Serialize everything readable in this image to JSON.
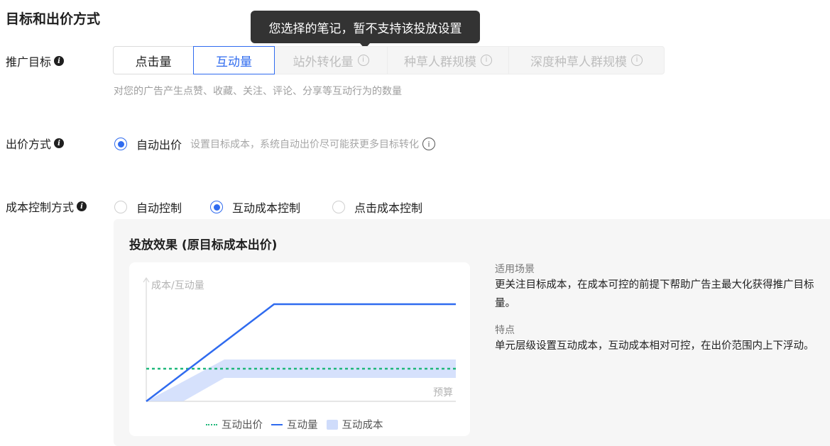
{
  "section": {
    "title": "目标和出价方式"
  },
  "tooltip": {
    "text": "您选择的笔记，暂不支持该投放设置"
  },
  "promotion_goal": {
    "label": "推广目标",
    "options": [
      {
        "label": "点击量",
        "state": "normal"
      },
      {
        "label": "互动量",
        "state": "selected"
      },
      {
        "label": "站外转化量",
        "state": "disabled"
      },
      {
        "label": "种草人群规模",
        "state": "disabled"
      },
      {
        "label": "深度种草人群规模",
        "state": "disabled"
      }
    ],
    "hint": "对您的广告产生点赞、收藏、关注、评论、分享等互动行为的数量"
  },
  "bid_method": {
    "label": "出价方式",
    "option": "自动出价",
    "description": "设置目标成本，系统自动出价尽可能获更多目标转化"
  },
  "cost_control": {
    "label": "成本控制方式",
    "options": [
      {
        "label": "自动控制",
        "checked": false
      },
      {
        "label": "互动成本控制",
        "checked": true
      },
      {
        "label": "点击成本控制",
        "checked": false
      }
    ]
  },
  "effect": {
    "title": "投放效果 (原目标成本出价)",
    "scenario_heading": "适用场景",
    "scenario_text": "更关注目标成本，在成本可控的前提下帮助广告主最大化获得推广目标量。",
    "feature_heading": "特点",
    "feature_text": "单元层级设置互动成本，互动成本相对可控，在出价范围内上下浮动。"
  },
  "chart_data": {
    "type": "line",
    "ylabel": "成本/互动量",
    "xlabel": "预算",
    "series": [
      {
        "name": "互动出价",
        "style": "dotted",
        "color": "#1fb87a"
      },
      {
        "name": "互动量",
        "style": "solid",
        "color": "#2f6bef"
      },
      {
        "name": "互动成本",
        "style": "area",
        "color": "#cfdcfb"
      }
    ]
  },
  "colors": {
    "accent": "#2f6bef",
    "bid": "#1fb87a",
    "cost_area": "#cfdcfb"
  }
}
